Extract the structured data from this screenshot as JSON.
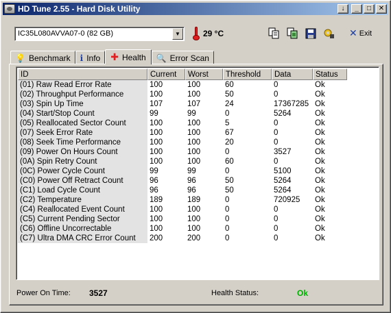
{
  "window": {
    "title": "HD Tune 2.55 - Hard Disk Utility"
  },
  "toolbar": {
    "drive": "IC35L080AVVA07-0 (82 GB)",
    "temperature": "29 °C",
    "exit_label": "Exit",
    "icons": [
      "copy-info-icon",
      "copy-screenshot-icon",
      "save-icon",
      "options-icon"
    ]
  },
  "tabs": [
    {
      "label": "Benchmark",
      "icon": "bulb-icon"
    },
    {
      "label": "Info",
      "icon": "info-icon"
    },
    {
      "label": "Health",
      "icon": "health-cross-icon",
      "active": true
    },
    {
      "label": "Error Scan",
      "icon": "magnifier-icon"
    }
  ],
  "table": {
    "columns": [
      "ID",
      "Current",
      "Worst",
      "Threshold",
      "Data",
      "Status"
    ],
    "rows": [
      [
        "(01) Raw Read Error Rate",
        "100",
        "100",
        "60",
        "0",
        "Ok"
      ],
      [
        "(02) Throughput Performance",
        "100",
        "100",
        "50",
        "0",
        "Ok"
      ],
      [
        "(03) Spin Up Time",
        "107",
        "107",
        "24",
        "17367285",
        "Ok"
      ],
      [
        "(04) Start/Stop Count",
        "99",
        "99",
        "0",
        "5264",
        "Ok"
      ],
      [
        "(05) Reallocated Sector Count",
        "100",
        "100",
        "5",
        "0",
        "Ok"
      ],
      [
        "(07) Seek Error Rate",
        "100",
        "100",
        "67",
        "0",
        "Ok"
      ],
      [
        "(08) Seek Time Performance",
        "100",
        "100",
        "20",
        "0",
        "Ok"
      ],
      [
        "(09) Power On Hours Count",
        "100",
        "100",
        "0",
        "3527",
        "Ok"
      ],
      [
        "(0A) Spin Retry Count",
        "100",
        "100",
        "60",
        "0",
        "Ok"
      ],
      [
        "(0C) Power Cycle Count",
        "99",
        "99",
        "0",
        "5100",
        "Ok"
      ],
      [
        "(C0) Power Off Retract Count",
        "96",
        "96",
        "50",
        "5264",
        "Ok"
      ],
      [
        "(C1) Load Cycle Count",
        "96",
        "96",
        "50",
        "5264",
        "Ok"
      ],
      [
        "(C2) Temperature",
        "189",
        "189",
        "0",
        "720925",
        "Ok"
      ],
      [
        "(C4) Reallocated Event Count",
        "100",
        "100",
        "0",
        "0",
        "Ok"
      ],
      [
        "(C5) Current Pending Sector",
        "100",
        "100",
        "0",
        "0",
        "Ok"
      ],
      [
        "(C6) Offline Uncorrectable",
        "100",
        "100",
        "0",
        "0",
        "Ok"
      ],
      [
        "(C7) Ultra DMA CRC Error Count",
        "200",
        "200",
        "0",
        "0",
        "Ok"
      ]
    ]
  },
  "footer": {
    "power_on_label": "Power On Time:",
    "power_on_value": "3527",
    "health_label": "Health Status:",
    "health_value": "Ok",
    "health_color": "#00b000"
  }
}
